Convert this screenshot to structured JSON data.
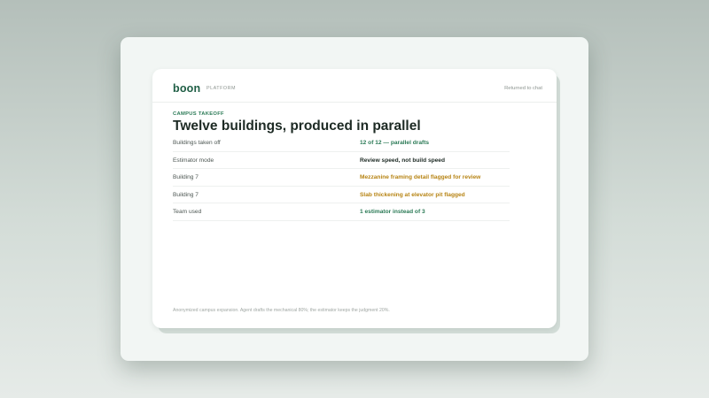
{
  "header": {
    "logo": "boon",
    "section": "PLATFORM",
    "back_link": "Returned to chat"
  },
  "content": {
    "eyebrow": "CAMPUS TAKEOFF",
    "title": "Twelve buildings, produced in parallel",
    "rows": [
      {
        "label": "Buildings taken off",
        "value": "12 of 12 — parallel drafts",
        "tone": "green"
      },
      {
        "label": "Estimator mode",
        "value": "Review speed, not build speed",
        "tone": "dark"
      },
      {
        "label": "Building 7",
        "value": "Mezzanine framing detail flagged for review",
        "tone": "amber"
      },
      {
        "label": "Building 7",
        "value": "Slab thickening at elevator pit flagged",
        "tone": "amber"
      },
      {
        "label": "Team used",
        "value": "1 estimator instead of 3",
        "tone": "green"
      }
    ],
    "footnote": "Anonymized campus expansion. Agent drafts the mechanical 80%; the estimator keeps the judgment 20%."
  },
  "colors": {
    "green": "#2b7a56",
    "dark": "#1d2a24",
    "amber": "#b78414",
    "brand": "#1f5e45"
  }
}
